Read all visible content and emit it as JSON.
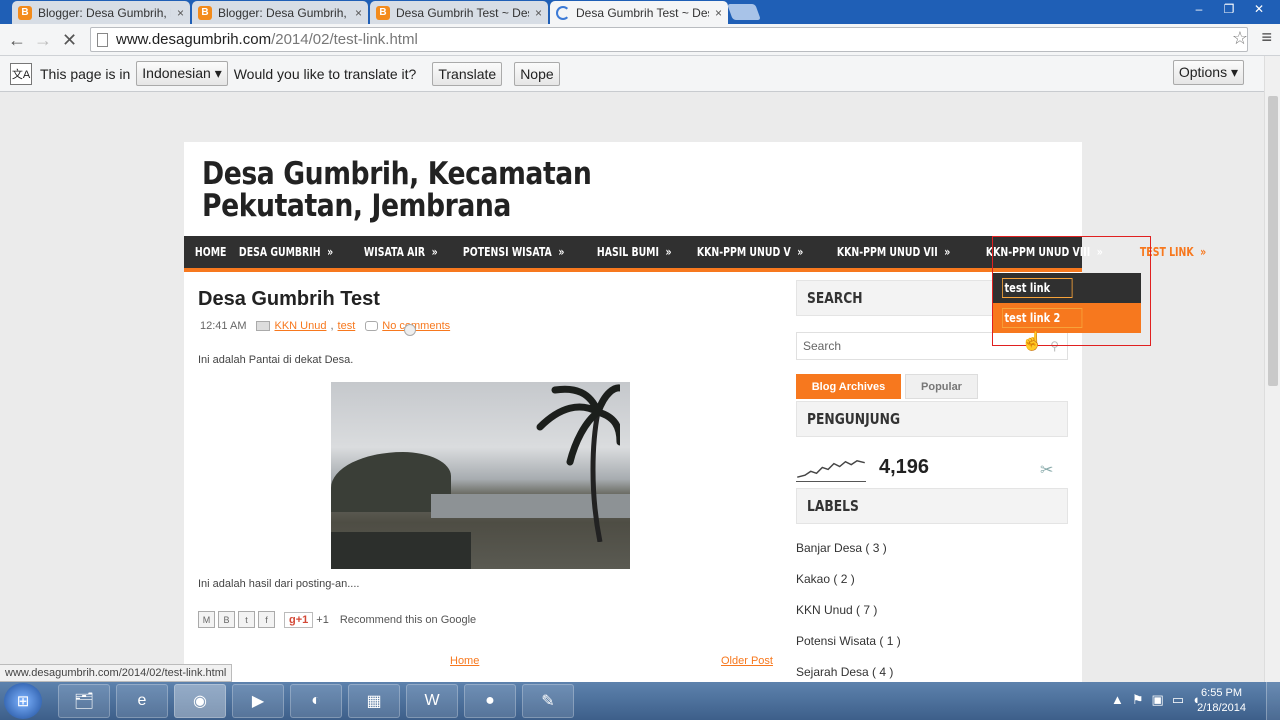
{
  "browser": {
    "tabs": [
      {
        "title": "Blogger: Desa Gumbrih, Ke",
        "favicon": "blogger-icon"
      },
      {
        "title": "Blogger: Desa Gumbrih, K",
        "favicon": "blogger-icon"
      },
      {
        "title": "Desa Gumbrih Test ~ Desa",
        "favicon": "blogger-icon"
      },
      {
        "title": "Desa Gumbrih Test ~ Desa",
        "favicon": "loading-spinner-icon"
      }
    ],
    "close_glyph": "×",
    "url_host": "www.desagumbrih.com",
    "url_path": "/2014/02/test-link.html",
    "window_buttons": [
      "–",
      "❐",
      "✕"
    ]
  },
  "translate_bar": {
    "prefix": "This page is in",
    "language": "Indonesian",
    "question": "Would you like to translate it?",
    "translate_label": "Translate",
    "nope_label": "Nope",
    "options_label": "Options"
  },
  "blog": {
    "title": "Desa Gumbrih, Kecamatan Pekutatan, Jembrana",
    "nav": [
      {
        "label": "HOME",
        "arrow": ""
      },
      {
        "label": "DESA GUMBRIH",
        "arrow": "»"
      },
      {
        "label": "WISATA AIR",
        "arrow": "»"
      },
      {
        "label": "POTENSI WISATA",
        "arrow": "»"
      },
      {
        "label": "HASIL BUMI",
        "arrow": "»"
      },
      {
        "label": "KKN-PPM UNUD V",
        "arrow": "»"
      },
      {
        "label": "KKN-PPM UNUD VII",
        "arrow": "»"
      },
      {
        "label": "KKN-PPM UNUD VIII",
        "arrow": "»"
      },
      {
        "label": "TEST LINK",
        "arrow": "»"
      }
    ],
    "dropdown": [
      "test link",
      "test link 2"
    ]
  },
  "post": {
    "title": "Desa Gumbrih Test",
    "time": "12:41 AM",
    "label1": "KKN Unud",
    "label2": "test",
    "comments": "No comments",
    "text1": "Ini adalah Pantai di dekat Desa.",
    "text2": "Ini adalah hasil dari posting-an....",
    "plus_count": "+1",
    "recommend": "Recommend this on Google",
    "home_link": "Home",
    "older_link": "Older Post"
  },
  "sidebar": {
    "search_head": "SEARCH",
    "search_placeholder": "Search",
    "tab_archives": "Blog Archives",
    "tab_popular": "Popular",
    "visitors_head": "PENGUNJUNG",
    "visitors_count": "4,196",
    "labels_head": "LABELS",
    "labels": [
      "Banjar Desa ( 3 )",
      "Kakao ( 2 )",
      "KKN Unud ( 7 )",
      "Potensi Wisata ( 1 )",
      "Sejarah Desa ( 4 )"
    ]
  },
  "status_url": "www.desagumbrih.com/2014/02/test-link.html",
  "taskbar": {
    "time": "6:55 PM",
    "date": "2/18/2014"
  },
  "colors": {
    "accent": "#f7781e",
    "nav_bg": "#303030",
    "chrome_blue": "#1f5fb6"
  }
}
